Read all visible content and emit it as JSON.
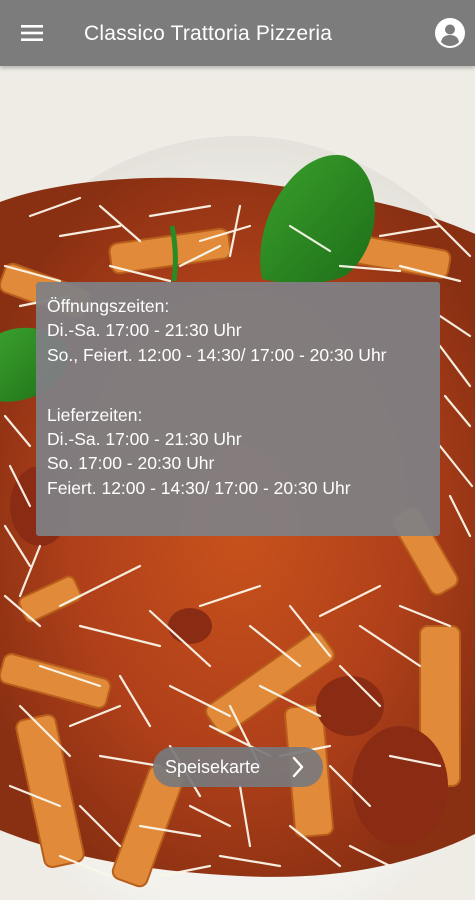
{
  "app": {
    "title": "Classico Trattoria Pizzeria"
  },
  "icons": {
    "menu": "hamburger-menu-icon",
    "profile": "account-circle-icon",
    "chevron": "chevron-right-icon"
  },
  "colors": {
    "appbar": "#7c7c7c",
    "card": "#808084",
    "text": "#ffffff"
  },
  "opening_hours": {
    "heading": "Öffnungszeiten:",
    "line1": "Di.-Sa. 17:00 - 21:30 Uhr",
    "line2": "So., Feiert. 12:00 - 14:30/ 17:00 - 20:30 Uhr"
  },
  "delivery_hours": {
    "heading": "Lieferzeiten:",
    "line1": "Di.-Sa. 17:00 - 21:30 Uhr",
    "line2": "So. 17:00 - 20:30 Uhr",
    "line3": "Feiert. 12:00 - 14:30/ 17:00 - 20:30 Uhr"
  },
  "menu_button": {
    "label": "Speisekarte"
  }
}
